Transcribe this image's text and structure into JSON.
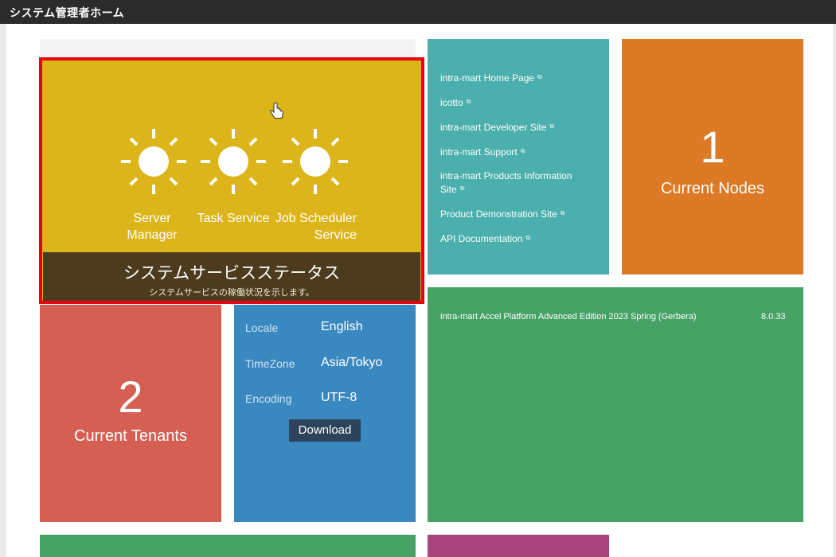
{
  "header": {
    "title": "システム管理者ホーム"
  },
  "services_tile": {
    "services": [
      {
        "label": "Server\nManager",
        "icon": "sun-icon"
      },
      {
        "label": "Task Service",
        "icon": "sun-icon"
      },
      {
        "label": "Job Scheduler\nService",
        "icon": "sun-icon"
      }
    ],
    "title": "システムサービスステータス",
    "subtitle": "システムサービスの稼働状況を示します。",
    "color": "#dcb51a"
  },
  "links_tile": {
    "links": [
      {
        "label": "intra-mart Home Page"
      },
      {
        "label": "icotto"
      },
      {
        "label": "intra-mart Developer Site"
      },
      {
        "label": "intra-mart Support"
      },
      {
        "label": "intra-mart Products Information Site"
      },
      {
        "label": "Product Demonstration Site"
      },
      {
        "label": "API Documentation"
      }
    ],
    "external_icon": "external-link-icon",
    "color": "#4aafad"
  },
  "nodes_tile": {
    "count": "1",
    "label": "Current Nodes",
    "color": "#dc7a26"
  },
  "tenants_tile": {
    "count": "2",
    "label": "Current Tenants",
    "color": "#d55f52"
  },
  "locale_tile": {
    "locale_key": "Locale",
    "locale_value": "English",
    "timezone_key": "TimeZone",
    "timezone_value": "Asia/Tokyo",
    "encoding_key": "Encoding",
    "encoding_value": "UTF-8",
    "download_label": "Download",
    "color": "#3a88c0"
  },
  "version_tile": {
    "product": "intra-mart Accel Platform Advanced Edition 2023 Spring (Gerbera)",
    "version": "8.0.33",
    "color": "#47a266"
  },
  "colors": {
    "highlight_border": "#e60012",
    "titlebar": "#2b2b2b"
  }
}
